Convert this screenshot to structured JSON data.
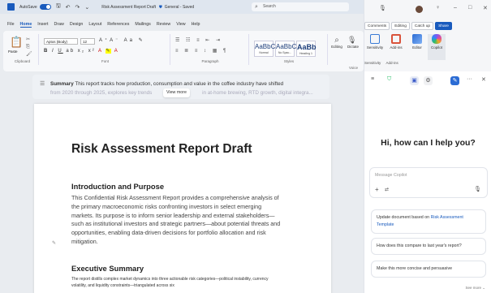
{
  "titlebar": {
    "autosave_label": "AutoSave",
    "document_title": "Risk Assessment Report Draft",
    "sensitivity": "General - Saved",
    "search_placeholder": "Search"
  },
  "menu": [
    "File",
    "Home",
    "Insert",
    "Draw",
    "Design",
    "Layout",
    "References",
    "Mailings",
    "Review",
    "View",
    "Help"
  ],
  "ribbon": {
    "paste_label": "Paste",
    "clipboard_label": "Clipboard",
    "font_name": "Aptos (Body)",
    "font_size": "12",
    "font_group_label": "Font",
    "paragraph_label": "Paragraph",
    "styles": [
      {
        "preview": "AaBbCc",
        "name": "Normal"
      },
      {
        "preview": "AaBbCc",
        "name": "No Spac..."
      },
      {
        "preview": "AaBb",
        "name": "Heading 1"
      }
    ],
    "styles_label": "Styles",
    "editing_label": "Editing",
    "dictate_label": "Dictate",
    "voice_label": "Voice"
  },
  "summary": {
    "label": "Summary",
    "text": "This report tracks how production, consumption and value in the coffee industry have shifted",
    "faded_text": "from 2020 through 2025, explores key trends",
    "faded_tail": "in at-home brewing, RTD growth, digital integra...",
    "view_more": "View more"
  },
  "document": {
    "title": "Risk Assessment Report Draft",
    "intro_heading": "Introduction and Purpose",
    "intro_body": "This Confidential Risk Assessment Report provides a comprehensive analysis of the primary macroeconomic risks confronting investors in select emerging markets. Its purpose is to inform senior leadership and external stakeholders—such as institutional investors and strategic partners—about potential threats and opportunities, enabling data-driven decisions for portfolio allocation and risk mitigation.",
    "exec_heading": "Executive Summary",
    "exec_body": "The report distills complex market dynamics into three actionable risk categories—political instability, currency volatility, and liquidity constraints—triangulated across six"
  },
  "copilot_ribbon": {
    "buttons": [
      "Comments",
      "Editing",
      "Catch up",
      "Share"
    ],
    "apps": [
      {
        "label": "Sensitivity",
        "color": "#3a7bd5"
      },
      {
        "label": "Add-ins",
        "color": "#d9533b"
      },
      {
        "label": "Editor",
        "color": "#2b6cd4"
      },
      {
        "label": "Copilot",
        "color": "#7a5af5"
      }
    ],
    "group_labels": [
      "Sensitivity",
      "Add-ins"
    ]
  },
  "copilot": {
    "greeting": "Hi, how can I help you?",
    "prompt_placeholder": "Message Copilot",
    "suggestion_1_prefix": "Update document based on",
    "suggestion_1_link": "Risk Assessment Template",
    "suggestion_2": "How does this compare to last year's report?",
    "suggestion_3": "Make this more concise and persuasive",
    "see_more": "See more"
  }
}
